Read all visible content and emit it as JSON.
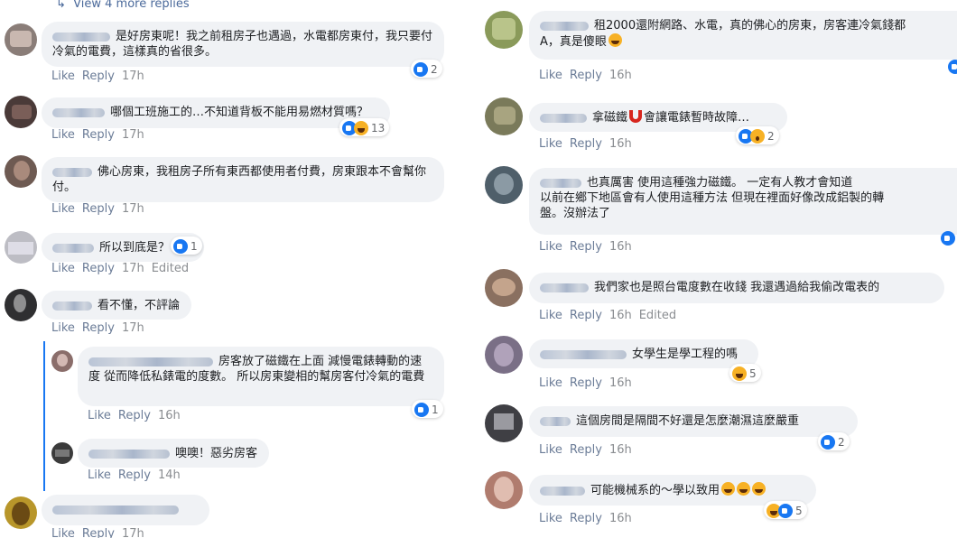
{
  "left": {
    "view_more": "View 4 more replies",
    "comments": [
      {
        "text": "是好房東呢！我之前租房子也遇過，水電都房東付，我只要付冷氣的電費，這樣真的省很多。",
        "like": "Like",
        "reply": "Reply",
        "time": "17h",
        "edited": "",
        "reaction_count": "2"
      },
      {
        "text": "哪個工班施工的…不知道背板不能用易燃材質嗎？",
        "like": "Like",
        "reply": "Reply",
        "time": "17h",
        "edited": "",
        "reaction_count": "13"
      },
      {
        "text": "佛心房東，我租房子所有東西都使用者付費，房東跟本不會幫你付。",
        "like": "Like",
        "reply": "Reply",
        "time": "17h",
        "edited": "",
        "reaction_count": ""
      },
      {
        "text": "所以到底是？",
        "like": "Like",
        "reply": "Reply",
        "time": "17h",
        "edited": "Edited",
        "reaction_count": "1"
      },
      {
        "text": "看不懂，不評論",
        "like": "Like",
        "reply": "Reply",
        "time": "17h",
        "edited": "",
        "reaction_count": ""
      },
      {
        "text": "房客放了磁鐵在上面 減慢電錶轉動的速度 從而降低私錶電的度數。 所以房東變相的幫房客付冷氣的電費",
        "like": "Like",
        "reply": "Reply",
        "time": "16h",
        "edited": "",
        "reaction_count": "1"
      },
      {
        "text": "噢噢！惡劣房客",
        "like": "Like",
        "reply": "Reply",
        "time": "14h",
        "edited": "",
        "reaction_count": ""
      },
      {
        "text": "",
        "like": "Like",
        "reply": "Reply",
        "time": "17h",
        "edited": "",
        "reaction_count": ""
      }
    ]
  },
  "right": {
    "comments": [
      {
        "text": "租2000還附網路、水電，真的佛心的房東，房客連冷氣錢都",
        "text2": "A，真是傻眼",
        "like": "Like",
        "reply": "Reply",
        "time": "16h",
        "edited": "",
        "reaction_count": ""
      },
      {
        "text": "拿磁鐵",
        "text_b": "會讓電錶暫時故障…",
        "like": "Like",
        "reply": "Reply",
        "time": "16h",
        "edited": "",
        "reaction_count": "2"
      },
      {
        "text": "也真厲害 使用這種強力磁鐵。 一定有人教才會知道",
        "text2": "以前在鄉下地區會有人使用這種方法 但現在裡面好像改成鋁製的轉",
        "text3": "盤。沒辦法了",
        "like": "Like",
        "reply": "Reply",
        "time": "16h",
        "edited": "",
        "reaction_count": ""
      },
      {
        "text": "我們家也是照台電度數在收錢 我還遇過給我偷改電表的",
        "like": "Like",
        "reply": "Reply",
        "time": "16h",
        "edited": "Edited",
        "reaction_count": ""
      },
      {
        "text": "女學生是學工程的嗎",
        "like": "Like",
        "reply": "Reply",
        "time": "16h",
        "edited": "",
        "reaction_count": "5"
      },
      {
        "text": "這個房間是隔間不好還是怎麼潮濕這麼嚴重",
        "like": "Like",
        "reply": "Reply",
        "time": "16h",
        "edited": "",
        "reaction_count": "2"
      },
      {
        "text": "可能機械系的～學以致用",
        "like": "Like",
        "reply": "Reply",
        "time": "16h",
        "edited": "",
        "reaction_count": "5"
      }
    ]
  },
  "colors": {
    "bubble": "#f0f2f5",
    "like_blue": "#1877f2",
    "meta_gray": "#8a8d91",
    "thread_line": "#1877f2"
  }
}
